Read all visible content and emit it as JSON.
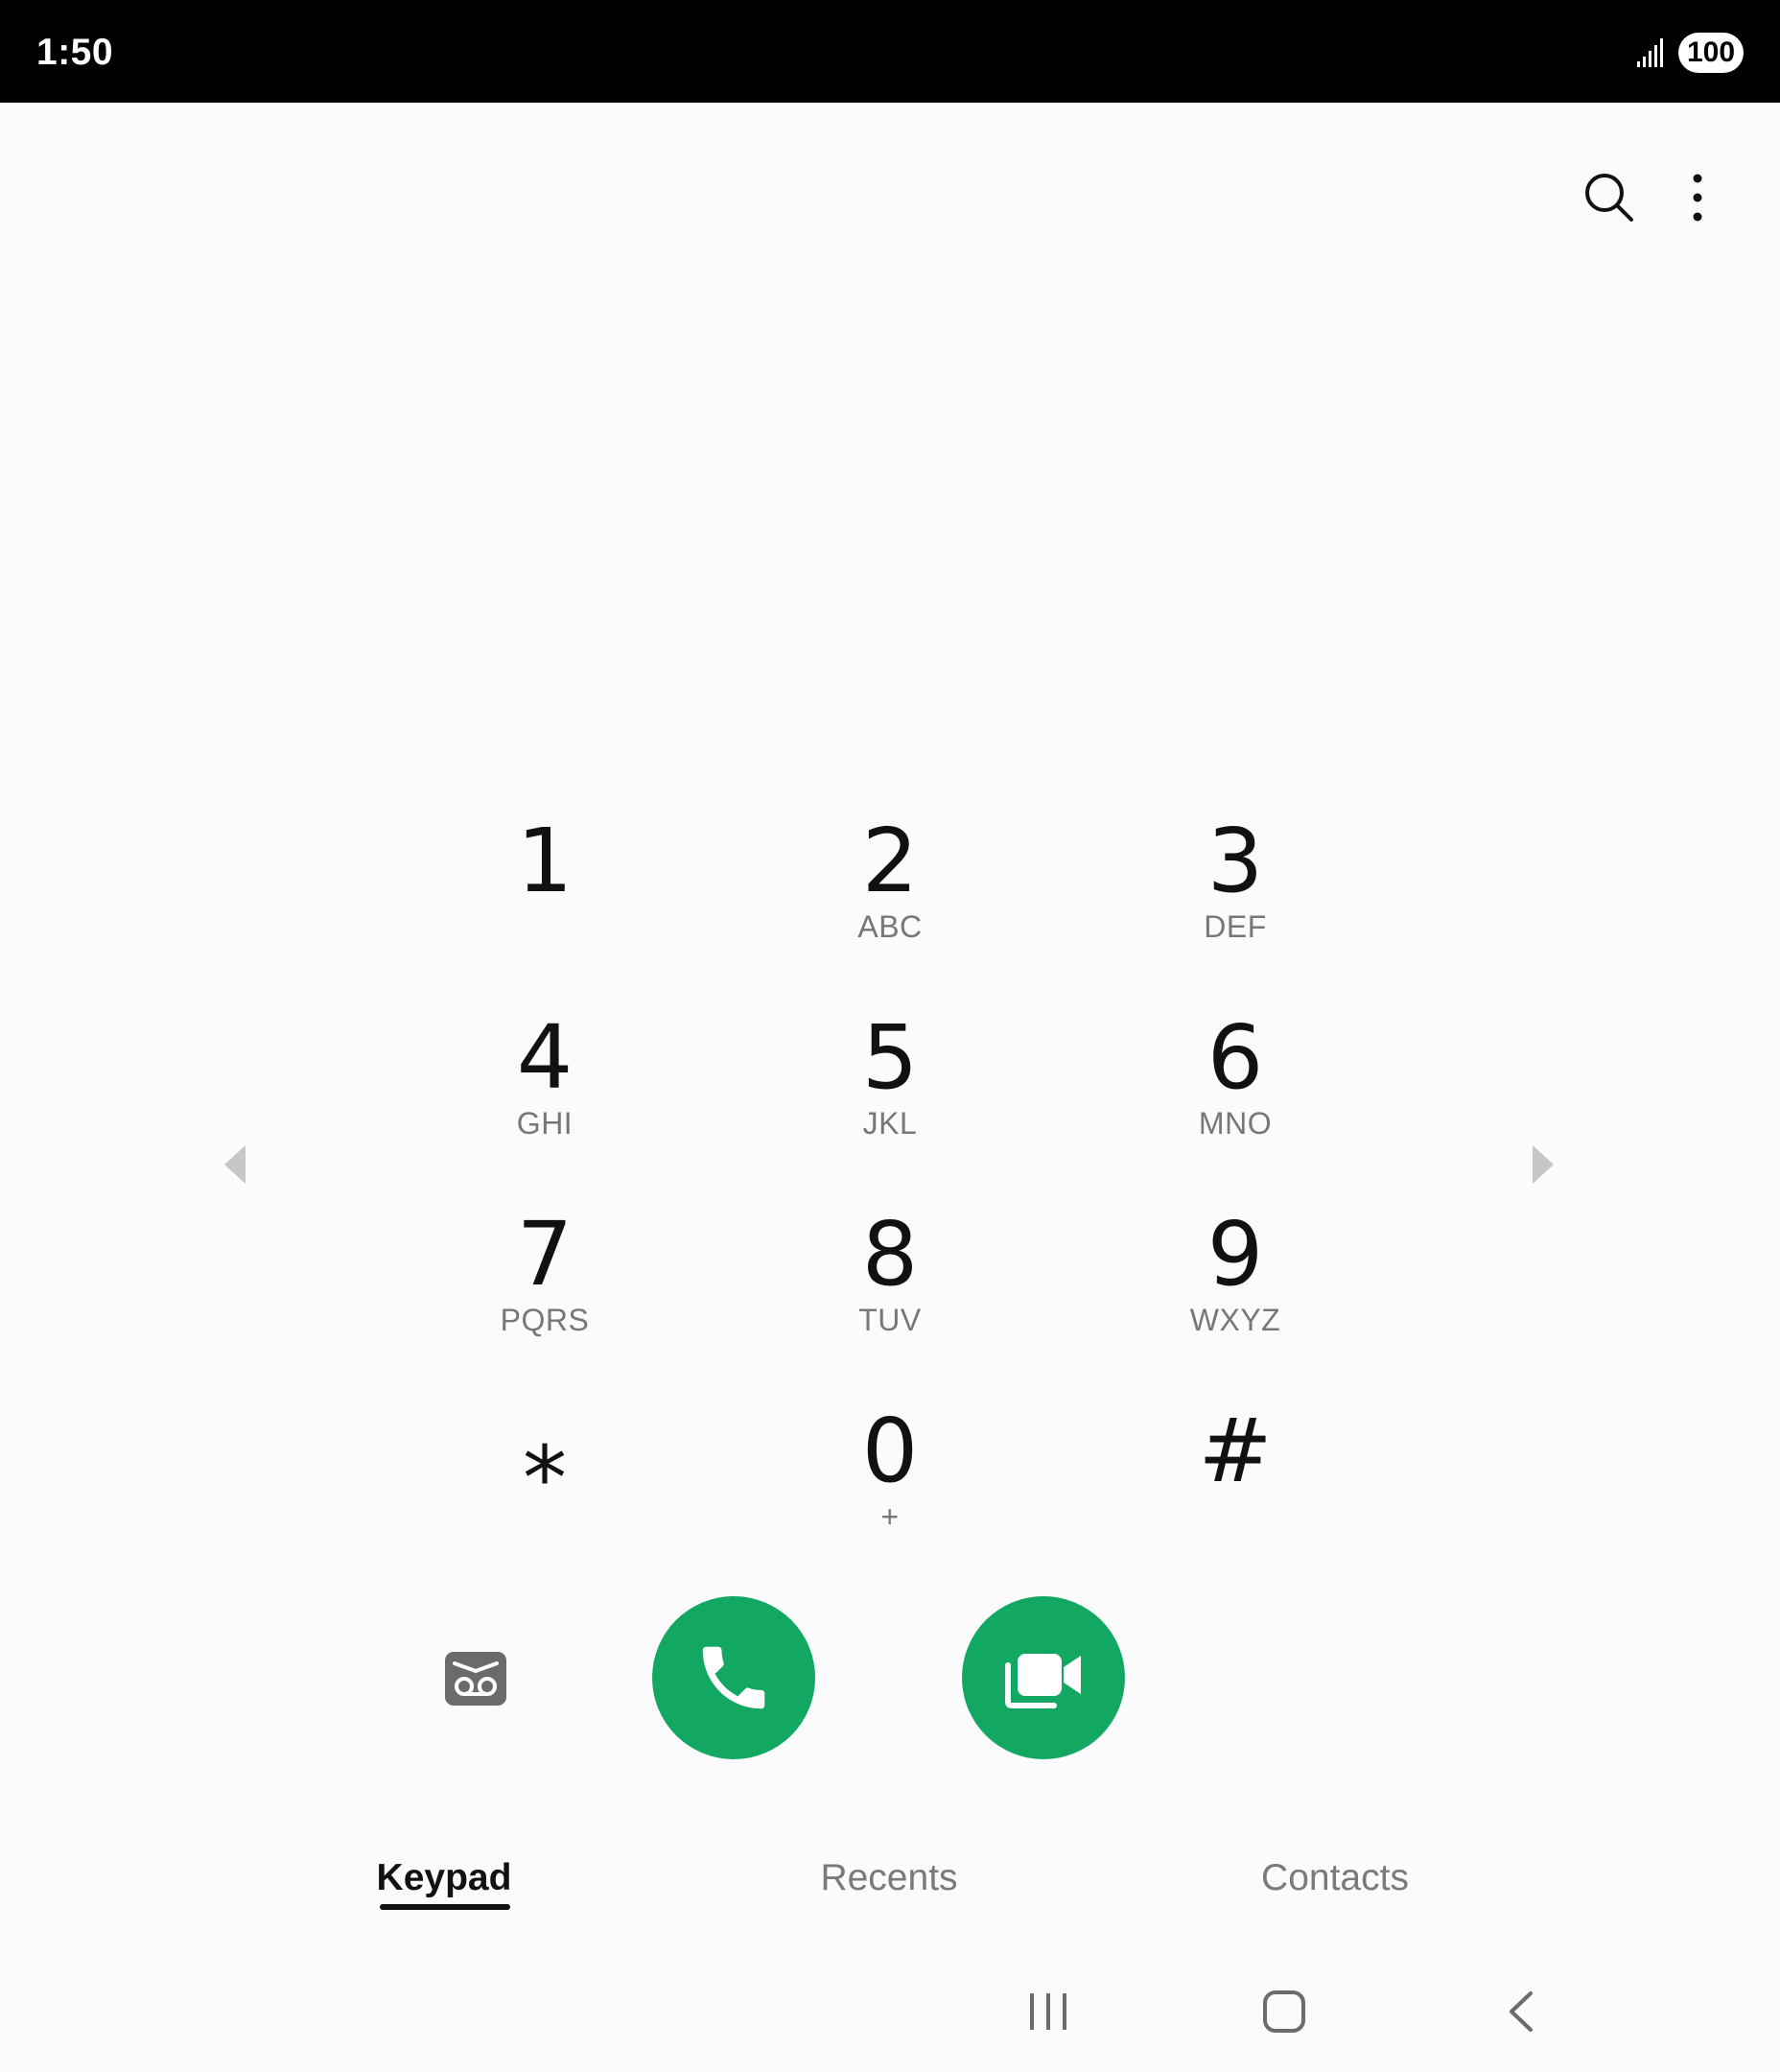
{
  "status_bar": {
    "time": "1:50",
    "battery": "100",
    "signal_icon": "cellular-signal-icon"
  },
  "toolbar": {
    "search_icon": "search-icon",
    "more_icon": "more-options-icon"
  },
  "keypad": {
    "keys": [
      {
        "digit": "1",
        "letters": ""
      },
      {
        "digit": "2",
        "letters": "ABC"
      },
      {
        "digit": "3",
        "letters": "DEF"
      },
      {
        "digit": "4",
        "letters": "GHI"
      },
      {
        "digit": "5",
        "letters": "JKL"
      },
      {
        "digit": "6",
        "letters": "MNO"
      },
      {
        "digit": "7",
        "letters": "PQRS"
      },
      {
        "digit": "8",
        "letters": "TUV"
      },
      {
        "digit": "9",
        "letters": "WXYZ"
      },
      {
        "digit": "⁎",
        "letters": ""
      },
      {
        "digit": "0",
        "letters": "+"
      },
      {
        "digit": "#",
        "letters": ""
      }
    ]
  },
  "actions": {
    "voicemail_icon": "voicemail-icon",
    "call_icon": "phone-icon",
    "video_call_icon": "video-call-icon"
  },
  "tabs": [
    {
      "label": "Keypad",
      "active": true
    },
    {
      "label": "Recents",
      "active": false
    },
    {
      "label": "Contacts",
      "active": false
    }
  ],
  "colors": {
    "accent_green": "#12a862",
    "background": "#fbfbfe",
    "status_bar": "#000000"
  }
}
